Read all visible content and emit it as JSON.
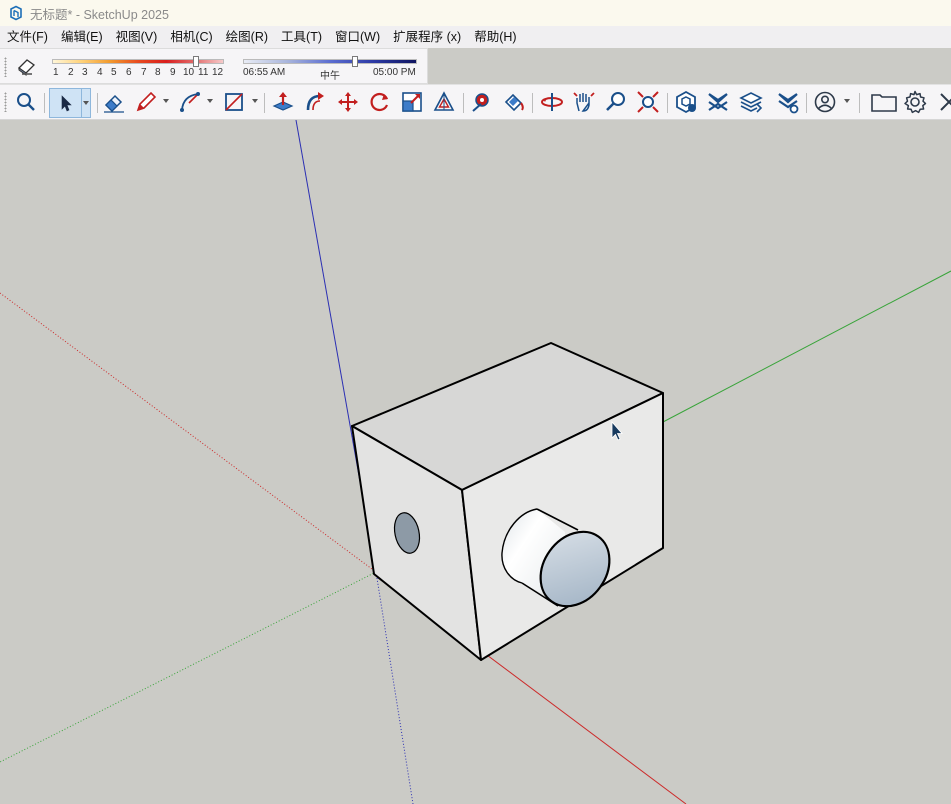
{
  "window": {
    "title": "无标题* - SketchUp 2025",
    "app_icon": "sketchup-logo-icon"
  },
  "menu": [
    {
      "label": "文件(F)"
    },
    {
      "label": "编辑(E)"
    },
    {
      "label": "视图(V)"
    },
    {
      "label": "相机(C)"
    },
    {
      "label": "绘图(R)"
    },
    {
      "label": "工具(T)"
    },
    {
      "label": "窗口(W)"
    },
    {
      "label": "扩展程序 (x)"
    },
    {
      "label": "帮助(H)"
    }
  ],
  "shadows": {
    "toggle_icon": "shadow-settings-icon",
    "month_ticks": [
      "1",
      "2",
      "3",
      "4",
      "5",
      "6",
      "7",
      "8",
      "9",
      "10",
      "11",
      "12"
    ],
    "month_position": 0.85,
    "time_labels": {
      "start": "06:55 AM",
      "mid": "中午",
      "end": "05:00 PM"
    },
    "time_position": 0.65
  },
  "toolbar": {
    "tools": [
      "search-icon",
      "select-icon",
      "eraser-icon",
      "pencil-icon",
      "arc-icon",
      "rectangle-icon",
      "push-pull-icon",
      "follow-me-icon",
      "move-icon",
      "rotate-icon",
      "scale-icon",
      "offset-icon",
      "tape-measure-icon",
      "paint-bucket-icon",
      "orbit-icon",
      "pan-icon",
      "zoom-icon",
      "zoom-extents-icon",
      "warehouse-icon",
      "extension-warehouse-icon",
      "layers-icon",
      "scene-settings-icon",
      "account-icon",
      "folder-icon",
      "settings-icon",
      "close-icon"
    ],
    "active_tool": "select-icon"
  },
  "viewport": {
    "background": "#cbcbc6",
    "axes": {
      "red": "#cc2a2a",
      "green": "#39a43a",
      "blue": "#2b2fb3"
    },
    "model": "box-with-hole-and-cylinder"
  }
}
